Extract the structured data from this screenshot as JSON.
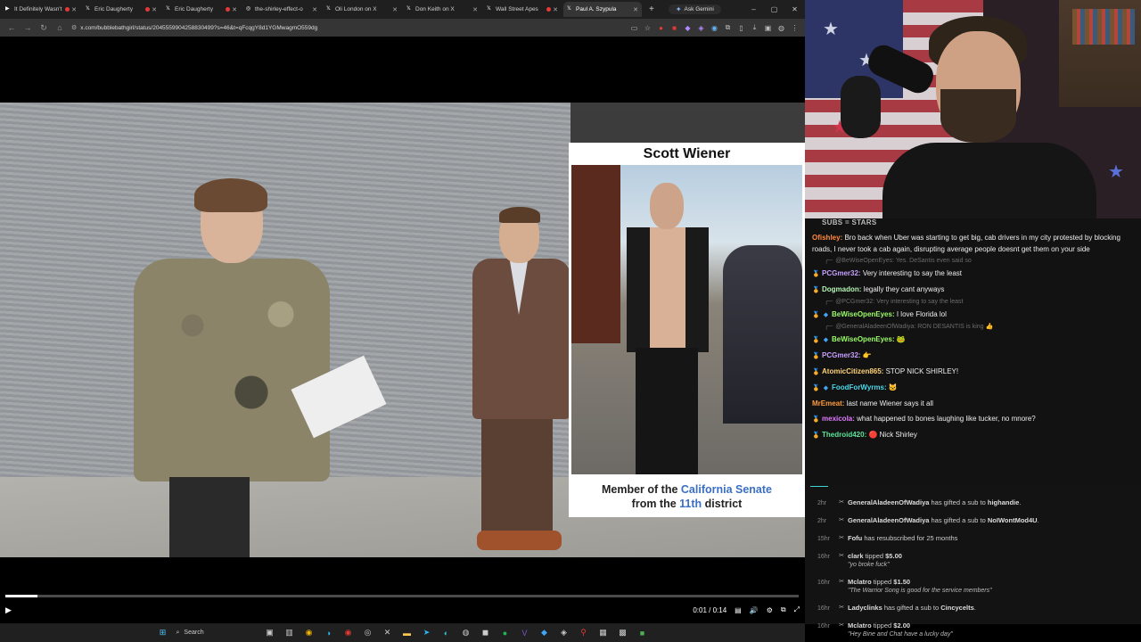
{
  "browser": {
    "tabs": [
      {
        "title": "It Definitely Wasn't",
        "icon": "video-icon",
        "active": false,
        "recording": true
      },
      {
        "title": "Eric Daugherty",
        "icon": "x-icon",
        "active": false,
        "recording": true
      },
      {
        "title": "Eric Daugherty",
        "icon": "x-icon",
        "active": false,
        "recording": true
      },
      {
        "title": "the-shirley-effect-o",
        "icon": "globe-icon",
        "active": false,
        "recording": false
      },
      {
        "title": "Oli London on X",
        "icon": "x-icon",
        "active": false,
        "recording": false
      },
      {
        "title": "Don Keith on X",
        "icon": "x-icon",
        "active": false,
        "recording": false
      },
      {
        "title": "Wall Street Apes",
        "icon": "x-icon",
        "active": false,
        "recording": true
      },
      {
        "title": "Paul A. Szypula",
        "icon": "x-icon",
        "active": true,
        "recording": false
      }
    ],
    "new_tab": "+",
    "gemini_label": "Ask Gemini",
    "url": "x.com/bubblebathgirl/status/2045559904258830499?s=46&t=qFcqgY8d1YGMwagmO559dg",
    "window_controls": [
      "–",
      "▢",
      "✕"
    ]
  },
  "video": {
    "inset_title": "Scott Wiener",
    "caption_prefix": "Member of the ",
    "caption_highlight1": "California Senate",
    "caption_mid": "from the ",
    "caption_highlight2": "11th",
    "caption_suffix": " district",
    "time": "0:01 / 0:14",
    "progress": 0.04,
    "play_icon": "▶"
  },
  "taskbar": {
    "search_label": "Search"
  },
  "chat": {
    "header": "SUBS = STARS",
    "messages": [
      {
        "kind": "msg",
        "badge": "",
        "author": "Ofishley:",
        "color": "#ff8a3d",
        "text": "Bro back when Uber was starting to get big, cab drivers in my city protested by blocking roads, I never took a cab again, disrupting average people doesnt get them on your side"
      },
      {
        "kind": "reply",
        "text": "@BeWiseOpenEyes: Yes. DeSantis even said so"
      },
      {
        "kind": "msg",
        "badge": "🏅",
        "author": "PCGmer32:",
        "color": "#c7a0ff",
        "text": "Very interesting to say the least"
      },
      {
        "kind": "msg",
        "badge": "🏅",
        "author": "Dogmadon:",
        "color": "#b5f5b5",
        "text": "legally they cant anyways"
      },
      {
        "kind": "reply",
        "text": "@PCGmer32: Very interesting to say the least"
      },
      {
        "kind": "msg",
        "badge": "🏅",
        "badge2": "◆",
        "author": "BeWiseOpenEyes:",
        "color": "#9bfc6a",
        "text": "I love Florida lol"
      },
      {
        "kind": "reply",
        "text": "@GeneralAladeenOfWadiya: RON DESANTIS is king 👍"
      },
      {
        "kind": "msg",
        "badge": "🏅",
        "badge2": "◆",
        "author": "BeWiseOpenEyes:",
        "color": "#9bfc6a",
        "text": "🐸"
      },
      {
        "kind": "msg",
        "badge": "🏅",
        "author": "PCGmer32:",
        "color": "#c7a0ff",
        "text": "👉"
      },
      {
        "kind": "msg",
        "badge": "🏅",
        "author": "AtomicCitizen865:",
        "color": "#ffd37a",
        "text": "STOP NICK SHIRLEY!"
      },
      {
        "kind": "msg",
        "badge": "🏅",
        "badge2": "◆",
        "author": "FoodForWyrms:",
        "color": "#48d8e8",
        "text": "🐱"
      },
      {
        "kind": "msg",
        "badge": "",
        "author": "MrEmeat:",
        "color": "#ff9b3d",
        "text": "last name Wiener says it all"
      },
      {
        "kind": "msg",
        "badge": "🏅",
        "author": "mexicola:",
        "color": "#e07aff",
        "text": "what happened to bones laughing like tucker, no mnore?"
      },
      {
        "kind": "msg",
        "badge": "🏅",
        "author": "Thedroid420:",
        "color": "#5be39a",
        "text": "🔴 Nick Shirley"
      }
    ]
  },
  "events": [
    {
      "time": "2hr",
      "icon": "gift-icon",
      "glyph": "✂",
      "name": "GeneralAladeenOfWadiya",
      "text": " has gifted a sub to ",
      "target": "highandie",
      "suffix": ".",
      "sub": ""
    },
    {
      "time": "2hr",
      "icon": "gift-icon",
      "glyph": "✂",
      "name": "GeneralAladeenOfWadiya",
      "text": " has gifted a sub to ",
      "target": "NoIWontMod4U",
      "suffix": ".",
      "sub": ""
    },
    {
      "time": "15hr",
      "icon": "gift-icon",
      "glyph": "✂",
      "name": "Fofu",
      "text": " has resubscribed for 25 months",
      "target": "",
      "suffix": "",
      "sub": ""
    },
    {
      "time": "16hr",
      "icon": "tip-icon",
      "glyph": "✂",
      "name": "clark",
      "text": " tipped ",
      "target": "$5.00",
      "suffix": "",
      "sub": "\"yo broke fuck\""
    },
    {
      "time": "16hr",
      "icon": "tip-icon",
      "glyph": "✂",
      "name": "Mclatro",
      "text": " tipped ",
      "target": "$1.50",
      "suffix": "",
      "sub": "\"The Warrior Song is good for the service members\""
    },
    {
      "time": "16hr",
      "icon": "gift-icon",
      "glyph": "✂",
      "name": "Ladyclinks",
      "text": " has gifted a sub to ",
      "target": "Cincycelts",
      "suffix": ".",
      "sub": ""
    },
    {
      "time": "16hr",
      "icon": "tip-icon",
      "glyph": "✂",
      "name": "Mclatro",
      "text": " tipped ",
      "target": "$2.00",
      "suffix": "",
      "sub": "\"Hey Bine and Chat have a lucky day\""
    }
  ]
}
